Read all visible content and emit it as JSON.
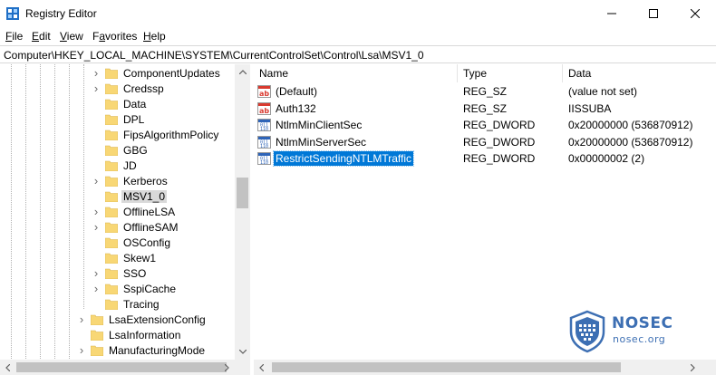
{
  "window": {
    "title": "Registry Editor",
    "icons": {
      "app": "registry-editor-icon",
      "minimize": "minimize-icon",
      "maximize": "maximize-icon",
      "close": "close-icon"
    }
  },
  "menu": [
    {
      "label": "File",
      "mnemonic": "F",
      "rest": "ile"
    },
    {
      "label": "Edit",
      "mnemonic": "E",
      "rest": "dit"
    },
    {
      "label": "View",
      "mnemonic": "V",
      "rest": "iew"
    },
    {
      "label": "Favorites",
      "mnemonic": "a",
      "pre": "F",
      "rest": "vorites"
    },
    {
      "label": "Help",
      "mnemonic": "H",
      "rest": "elp"
    }
  ],
  "address": "Computer\\HKEY_LOCAL_MACHINE\\SYSTEM\\CurrentControlSet\\Control\\Lsa\\MSV1_0",
  "tree": {
    "items": [
      {
        "label": "ComponentUpdates",
        "expandable": true,
        "selected": false
      },
      {
        "label": "Credssp",
        "expandable": true,
        "selected": false
      },
      {
        "label": "Data",
        "expandable": false,
        "selected": false
      },
      {
        "label": "DPL",
        "expandable": false,
        "selected": false
      },
      {
        "label": "FipsAlgorithmPolicy",
        "expandable": false,
        "selected": false
      },
      {
        "label": "GBG",
        "expandable": false,
        "selected": false
      },
      {
        "label": "JD",
        "expandable": false,
        "selected": false
      },
      {
        "label": "Kerberos",
        "expandable": true,
        "selected": false
      },
      {
        "label": "MSV1_0",
        "expandable": false,
        "selected": true
      },
      {
        "label": "OfflineLSA",
        "expandable": true,
        "selected": false
      },
      {
        "label": "OfflineSAM",
        "expandable": true,
        "selected": false
      },
      {
        "label": "OSConfig",
        "expandable": false,
        "selected": false
      },
      {
        "label": "Skew1",
        "expandable": false,
        "selected": false
      },
      {
        "label": "SSO",
        "expandable": true,
        "selected": false
      },
      {
        "label": "SspiCache",
        "expandable": true,
        "selected": false
      },
      {
        "label": "Tracing",
        "expandable": false,
        "selected": false
      },
      {
        "label": "LsaExtensionConfig",
        "expandable": true,
        "selected": false,
        "parent_level": true
      },
      {
        "label": "LsaInformation",
        "expandable": false,
        "selected": false,
        "parent_level": true
      },
      {
        "label": "ManufacturingMode",
        "expandable": true,
        "selected": false,
        "parent_level": true
      }
    ]
  },
  "list": {
    "columns": [
      "Name",
      "Type",
      "Data"
    ],
    "rows": [
      {
        "name": "(Default)",
        "type": "REG_SZ",
        "data": "(value not set)",
        "icon": "string-value-icon",
        "selected": false
      },
      {
        "name": "Auth132",
        "type": "REG_SZ",
        "data": "IISSUBA",
        "icon": "string-value-icon",
        "selected": false
      },
      {
        "name": "NtlmMinClientSec",
        "type": "REG_DWORD",
        "data": "0x20000000 (536870912)",
        "icon": "binary-value-icon",
        "selected": false
      },
      {
        "name": "NtlmMinServerSec",
        "type": "REG_DWORD",
        "data": "0x20000000 (536870912)",
        "icon": "binary-value-icon",
        "selected": false
      },
      {
        "name": "RestrictSendingNTLMTraffic",
        "type": "REG_DWORD",
        "data": "0x00000002 (2)",
        "icon": "binary-value-icon",
        "selected": true
      }
    ]
  },
  "watermark": {
    "title": "NOSEC",
    "subtitle": "nosec.org",
    "icon": "shield-logo-icon",
    "color": "#3d6fb3"
  },
  "colors": {
    "selection": "#0078d7",
    "tree_selection": "#d9d9d9",
    "folder": "#f8d775"
  }
}
